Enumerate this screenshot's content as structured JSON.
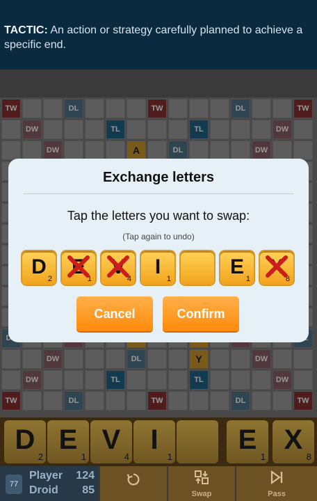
{
  "tip": {
    "term": "TACTIC:",
    "definition": "An action or strategy carefully planned to achieve a specific end."
  },
  "board": {
    "cells": [
      {
        "r": 0,
        "c": 0,
        "t": "tw",
        "label": "TW"
      },
      {
        "r": 0,
        "c": 3,
        "t": "dl",
        "label": "DL"
      },
      {
        "r": 0,
        "c": 7,
        "t": "tw",
        "label": "TW"
      },
      {
        "r": 0,
        "c": 11,
        "t": "dl",
        "label": "DL"
      },
      {
        "r": 0,
        "c": 14,
        "t": "tw",
        "label": "TW"
      },
      {
        "r": 1,
        "c": 1,
        "t": "dw",
        "label": "DW"
      },
      {
        "r": 1,
        "c": 5,
        "t": "tl",
        "label": "TL"
      },
      {
        "r": 1,
        "c": 9,
        "t": "tl",
        "label": "TL"
      },
      {
        "r": 1,
        "c": 13,
        "t": "dw",
        "label": "DW"
      },
      {
        "r": 2,
        "c": 2,
        "t": "dw",
        "label": "DW"
      },
      {
        "r": 2,
        "c": 6,
        "t": "tile",
        "label": "A"
      },
      {
        "r": 2,
        "c": 8,
        "t": "dl",
        "label": "DL"
      },
      {
        "r": 2,
        "c": 12,
        "t": "dw",
        "label": "DW"
      },
      {
        "r": 11,
        "c": 0,
        "t": "dl",
        "label": "DL"
      },
      {
        "r": 11,
        "c": 3,
        "t": "dw",
        "label": "DW"
      },
      {
        "r": 11,
        "c": 6,
        "t": "tile",
        "label": "N"
      },
      {
        "r": 11,
        "c": 9,
        "t": "tile",
        "label": "G"
      },
      {
        "r": 11,
        "c": 11,
        "t": "dw",
        "label": "DW"
      },
      {
        "r": 11,
        "c": 14,
        "t": "dl",
        "label": "DL"
      },
      {
        "r": 12,
        "c": 2,
        "t": "dw",
        "label": "DW"
      },
      {
        "r": 12,
        "c": 6,
        "t": "dl",
        "label": "DL"
      },
      {
        "r": 12,
        "c": 9,
        "t": "tile",
        "label": "Y"
      },
      {
        "r": 12,
        "c": 12,
        "t": "dw",
        "label": "DW"
      },
      {
        "r": 13,
        "c": 1,
        "t": "dw",
        "label": "DW"
      },
      {
        "r": 13,
        "c": 5,
        "t": "tl",
        "label": "TL"
      },
      {
        "r": 13,
        "c": 9,
        "t": "tl",
        "label": "TL"
      },
      {
        "r": 13,
        "c": 13,
        "t": "dw",
        "label": "DW"
      },
      {
        "r": 14,
        "c": 0,
        "t": "tw",
        "label": "TW"
      },
      {
        "r": 14,
        "c": 3,
        "t": "dl",
        "label": "DL"
      },
      {
        "r": 14,
        "c": 7,
        "t": "tw",
        "label": "TW"
      },
      {
        "r": 14,
        "c": 11,
        "t": "dl",
        "label": "DL"
      },
      {
        "r": 14,
        "c": 14,
        "t": "tw",
        "label": "TW"
      }
    ]
  },
  "modal": {
    "title": "Exchange letters",
    "instruction": "Tap the letters you want to swap:",
    "sub": "(Tap again to undo)",
    "tiles": [
      {
        "letter": "D",
        "points": "2",
        "selected": false
      },
      {
        "letter": "E",
        "points": "1",
        "selected": true
      },
      {
        "letter": "V",
        "points": "4",
        "selected": true
      },
      {
        "letter": "I",
        "points": "1",
        "selected": false
      },
      {
        "letter": "",
        "points": "",
        "selected": false
      },
      {
        "letter": "E",
        "points": "1",
        "selected": false
      },
      {
        "letter": "X",
        "points": "8",
        "selected": true
      }
    ],
    "cancel_label": "Cancel",
    "confirm_label": "Confirm"
  },
  "rack": [
    {
      "letter": "D",
      "points": "2"
    },
    {
      "letter": "E",
      "points": "1"
    },
    {
      "letter": "V",
      "points": "4"
    },
    {
      "letter": "I",
      "points": "1"
    },
    {
      "letter": "",
      "points": ""
    },
    {
      "letter": "E",
      "points": "1"
    },
    {
      "letter": "X",
      "points": "8"
    }
  ],
  "scores": {
    "avatar_label": "77",
    "player_label": "Player",
    "player_score": "124",
    "droid_label": "Droid",
    "droid_score": "85"
  },
  "actions": {
    "shuffle_icon": "shuffle-icon",
    "swap_label": "Swap",
    "pass_label": "Pass"
  },
  "colors": {
    "accent": "#ff8a0b",
    "tile": "#f2a21d",
    "selected_x": "#cc1d1d"
  }
}
